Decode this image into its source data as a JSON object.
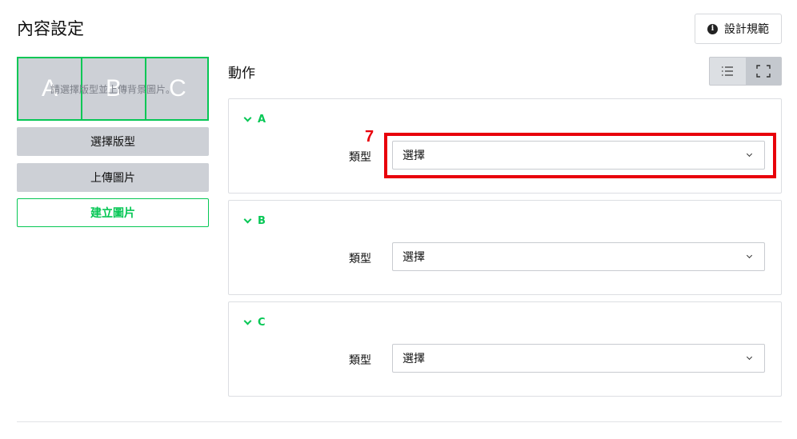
{
  "page_title": "內容設定",
  "guide_button": {
    "label": "設計規範",
    "icon": "info-icon"
  },
  "preview": {
    "hint": "請選擇版型並上傳背景圖片。",
    "areas": [
      "A",
      "B",
      "C"
    ]
  },
  "left_buttons": {
    "select_template": "選擇版型",
    "upload_image": "上傳圖片",
    "create_image": "建立圖片"
  },
  "actions_title": "動作",
  "view_toggle": {
    "list_icon": "list-icon",
    "expand_icon": "fullscreen-icon",
    "active": "expand"
  },
  "actions": [
    {
      "name": "A",
      "type_label": "類型",
      "select_value": "選擇"
    },
    {
      "name": "B",
      "type_label": "類型",
      "select_value": "選擇"
    },
    {
      "name": "C",
      "type_label": "類型",
      "select_value": "選擇"
    }
  ],
  "annotation": {
    "number": "7",
    "color": "#e8000b"
  },
  "colors": {
    "accent": "#06c755",
    "panel_gray": "#cdd0d6"
  }
}
